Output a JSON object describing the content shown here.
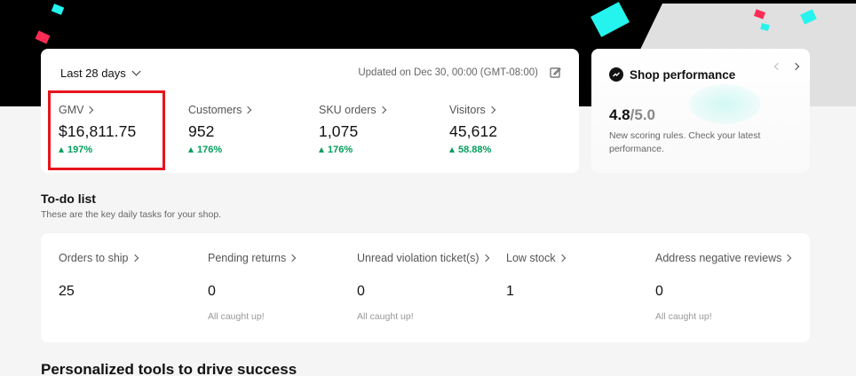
{
  "metrics": {
    "period_label": "Last 28 days",
    "updated_text": "Updated on Dec 30, 00:00 (GMT-08:00)",
    "items": [
      {
        "label": "GMV",
        "value": "$16,811.75",
        "delta": "197%"
      },
      {
        "label": "Customers",
        "value": "952",
        "delta": "176%"
      },
      {
        "label": "SKU orders",
        "value": "1,075",
        "delta": "176%"
      },
      {
        "label": "Visitors",
        "value": "45,612",
        "delta": "58.88%"
      }
    ]
  },
  "shop_performance": {
    "title": "Shop performance",
    "score": "4.8",
    "max_score": "/5.0",
    "description": "New scoring rules. Check your latest performance."
  },
  "todo": {
    "title": "To-do list",
    "subtitle": "These are the key daily tasks for your shop.",
    "items": [
      {
        "label": "Orders to ship",
        "value": "25",
        "note": ""
      },
      {
        "label": "Pending returns",
        "value": "0",
        "note": "All caught up!"
      },
      {
        "label": "Unread violation ticket(s)",
        "value": "0",
        "note": "All caught up!"
      },
      {
        "label": "Low stock",
        "value": "1",
        "note": ""
      },
      {
        "label": "Address negative reviews",
        "value": "0",
        "note": "All caught up!"
      }
    ]
  },
  "tools": {
    "title": "Personalized tools to drive success"
  },
  "colors": {
    "positive": "#009e5c",
    "highlight_border": "#e8141c",
    "brand_cyan": "#25f4ee",
    "brand_red": "#fe2c55"
  }
}
